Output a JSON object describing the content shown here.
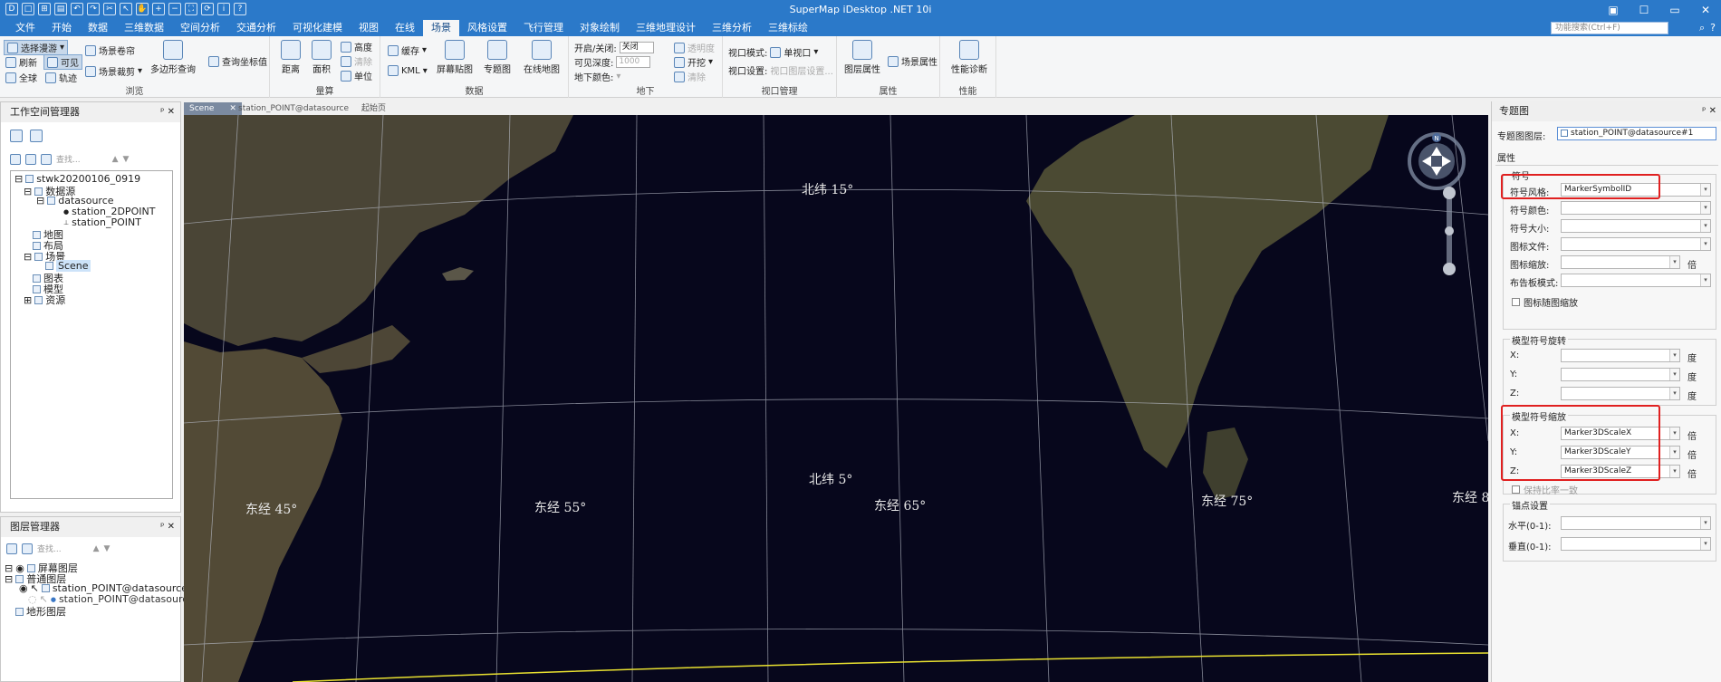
{
  "window": {
    "title": "SuperMap iDesktop .NET 10i",
    "controls": [
      "▣",
      "☐",
      "▭",
      "✕"
    ]
  },
  "menu": {
    "items": [
      "文件",
      "开始",
      "数据",
      "三维数据",
      "空间分析",
      "交通分析",
      "可视化建模",
      "视图",
      "在线",
      "场景",
      "风格设置",
      "飞行管理",
      "对象绘制",
      "三维地理设计",
      "三维分析",
      "三维标绘"
    ],
    "active_index": 9,
    "search_placeholder": "功能搜索(Ctrl+F)"
  },
  "ribbon": {
    "browse": {
      "label": "浏览",
      "select_roam": "选择漫游",
      "refresh": "刷新",
      "visible": "可见",
      "full_extent": "全球",
      "track": "轨迹",
      "scene_roll": "场景卷帘",
      "scene_clip": "场景裁剪",
      "polygon_query": "多边形查询",
      "query_coord": "查询坐标值"
    },
    "measure": {
      "label": "量算",
      "distance": "距离",
      "area": "面积",
      "height": "高度",
      "clear": "清除",
      "unit": "单位"
    },
    "data": {
      "label": "数据",
      "cache": "缓存",
      "kml": "KML",
      "screen_texture": "屏幕贴图",
      "thematic": "专题图",
      "online_map": "在线地图"
    },
    "underground": {
      "label": "地下",
      "toggle_label": "开启/关闭:",
      "toggle_value": "关闭",
      "depth_label": "可见深度:",
      "depth_value": "1000",
      "color_label": "地下颜色:",
      "transparency": "透明度",
      "excavate": "开挖",
      "clear": "清除"
    },
    "viewport": {
      "label": "视口管理",
      "mode_label": "视口模式:",
      "mode_value": "单视口",
      "settings_label": "视口设置:",
      "settings_value": "视口图层设置..."
    },
    "properties": {
      "label": "属性",
      "layer_props": "图层属性",
      "scene_props": "场景属性"
    },
    "performance": {
      "label": "性能",
      "diagnose": "性能诊断"
    }
  },
  "workspace": {
    "title": "工作空间管理器",
    "search_placeholder": "查找...",
    "tree": {
      "root": "stwk20200106_0919",
      "datasources": "数据源",
      "datasource": "datasource",
      "ds1": "station_2DPOINT",
      "ds2": "station_POINT",
      "maps": "地图",
      "layouts": "布局",
      "scenes": "场景",
      "scene": "Scene",
      "resources_icons": "图表",
      "models": "模型",
      "resources": "资源"
    }
  },
  "layers": {
    "title": "图层管理器",
    "search_placeholder": "查找...",
    "tree": {
      "screen": "屏幕图层",
      "normal": "普通图层",
      "layer1": "station_POINT@datasource#1",
      "layer2": "station_POINT@datasource",
      "terrain": "地形图层"
    }
  },
  "tabs": [
    {
      "label": "Scene",
      "active": true
    },
    {
      "label": "station_POINT@datasource",
      "active": false
    },
    {
      "label": "起始页",
      "active": false
    }
  ],
  "scene": {
    "lat_labels": [
      "北纬 15°",
      "北纬 5°"
    ],
    "lon_labels": [
      "东经 45°",
      "东经 55°",
      "东经 65°",
      "东经 75°",
      "东经 8"
    ],
    "compass_letter": "N"
  },
  "thematic": {
    "title": "专题图",
    "layer_label": "专题图图层:",
    "layer_value": "station_POINT@datasource#1",
    "properties_label": "属性",
    "symbol": {
      "title": "符号",
      "style_label": "符号风格:",
      "style_value": "MarkerSymbolID",
      "color_label": "符号颜色:",
      "size_label": "符号大小:",
      "icon_file_label": "图标文件:",
      "icon_scale_label": "图标缩放:",
      "billboard_label": "布告板模式:",
      "scale_with_icon": "图标随图缩放",
      "unit_times": "倍"
    },
    "rotation": {
      "title": "模型符号旋转",
      "x": "X:",
      "y": "Y:",
      "z": "Z:",
      "unit": "度"
    },
    "scale": {
      "title": "模型符号缩放",
      "x": "X:",
      "y": "Y:",
      "z": "Z:",
      "x_value": "Marker3DScaleX",
      "y_value": "Marker3DScaleY",
      "z_value": "Marker3DScaleZ",
      "unit": "倍",
      "keep_ratio": "保持比率一致"
    },
    "anchor": {
      "title": "锚点设置",
      "horizontal": "水平(0-1):",
      "vertical": "垂直(0-1):"
    }
  }
}
